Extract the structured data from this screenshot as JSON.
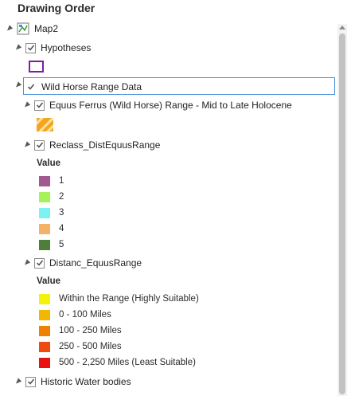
{
  "panel": {
    "title": "Drawing Order"
  },
  "tree": {
    "map": {
      "label": "Map2"
    },
    "hypotheses": {
      "label": "Hypotheses",
      "symbol_color": "#7b1fa2"
    },
    "wild_horse_group": {
      "label": "Wild Horse Range Data"
    },
    "equus_range_layer": {
      "label": "Equus Ferrus (Wild Horse) Range - Mid to Late Holocene",
      "symbol_color": "#f4a51c"
    },
    "reclass_layer": {
      "label": "Reclass_DistEquusRange",
      "value_header": "Value",
      "items": [
        {
          "label": "1",
          "color": "#a05a8f"
        },
        {
          "label": "2",
          "color": "#a6f25a"
        },
        {
          "label": "3",
          "color": "#7df2f2"
        },
        {
          "label": "4",
          "color": "#f4b266"
        },
        {
          "label": "5",
          "color": "#4f7d3a"
        }
      ]
    },
    "distanc_layer": {
      "label": "Distanc_EquusRange",
      "value_header": "Value",
      "items": [
        {
          "label": "Within the Range (Highly Suitable)",
          "color": "#f4f20a"
        },
        {
          "label": "0 - 100 Miles",
          "color": "#f2b800"
        },
        {
          "label": "100 - 250 Miles",
          "color": "#f08000"
        },
        {
          "label": "250 - 500 Miles",
          "color": "#ef4a10"
        },
        {
          "label": "500 - 2,250 Miles (Least Suitable)",
          "color": "#e81010"
        }
      ]
    },
    "historic_water": {
      "label": "Historic Water bodies"
    }
  }
}
